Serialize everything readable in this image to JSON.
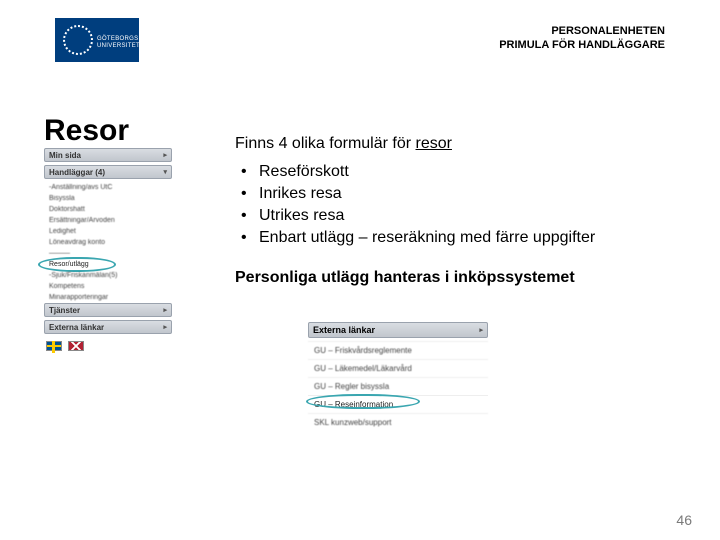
{
  "header": {
    "dept": "PERSONALENHETEN",
    "subtitle": "PRIMULA FÖR HANDLÄGGARE",
    "logo_line1": "GÖTEBORGS",
    "logo_line2": "UNIVERSITET"
  },
  "title": "Resor",
  "content": {
    "subhead_plain": "Finns 4 olika formulär för ",
    "subhead_underlined": "resor",
    "bullets": [
      "Reseförskott",
      "Inrikes resa",
      "Utrikes resa",
      "Enbart utlägg – reseräkning med färre uppgifter"
    ],
    "note": "Personliga utlägg hanteras i inköpssystemet"
  },
  "leftmenu": {
    "sections": [
      {
        "label": "Min sida",
        "arrow": "▸"
      },
      {
        "label": "Handläggar (4)",
        "arrow": "▾"
      }
    ],
    "items": [
      "-Anställning/avs UtC",
      "Bisyssla",
      "Doktorshatt",
      "Ersättningar/Arvoden",
      "Ledighet",
      "Löneavdrag konto",
      "———",
      "Resor/utlägg",
      "-Sjuk/Friskanmälan(5)",
      "Kompetens",
      "Minarapporteringar"
    ],
    "sections2": [
      {
        "label": "Tjänster",
        "arrow": "▸"
      },
      {
        "label": "Externa länkar",
        "arrow": "▸"
      }
    ],
    "highlightIndex": 7
  },
  "rightpanel": {
    "header": {
      "label": "Externa länkar",
      "arrow": "▸"
    },
    "items": [
      "GU – Friskvårdsreglemente",
      "GU – Läkemedel/Läkarvård",
      "GU – Regler bisyssla",
      "GU – Reseinformation",
      "SKL kunzweb/support"
    ],
    "highlightIndex": 3
  },
  "page_number": "46"
}
